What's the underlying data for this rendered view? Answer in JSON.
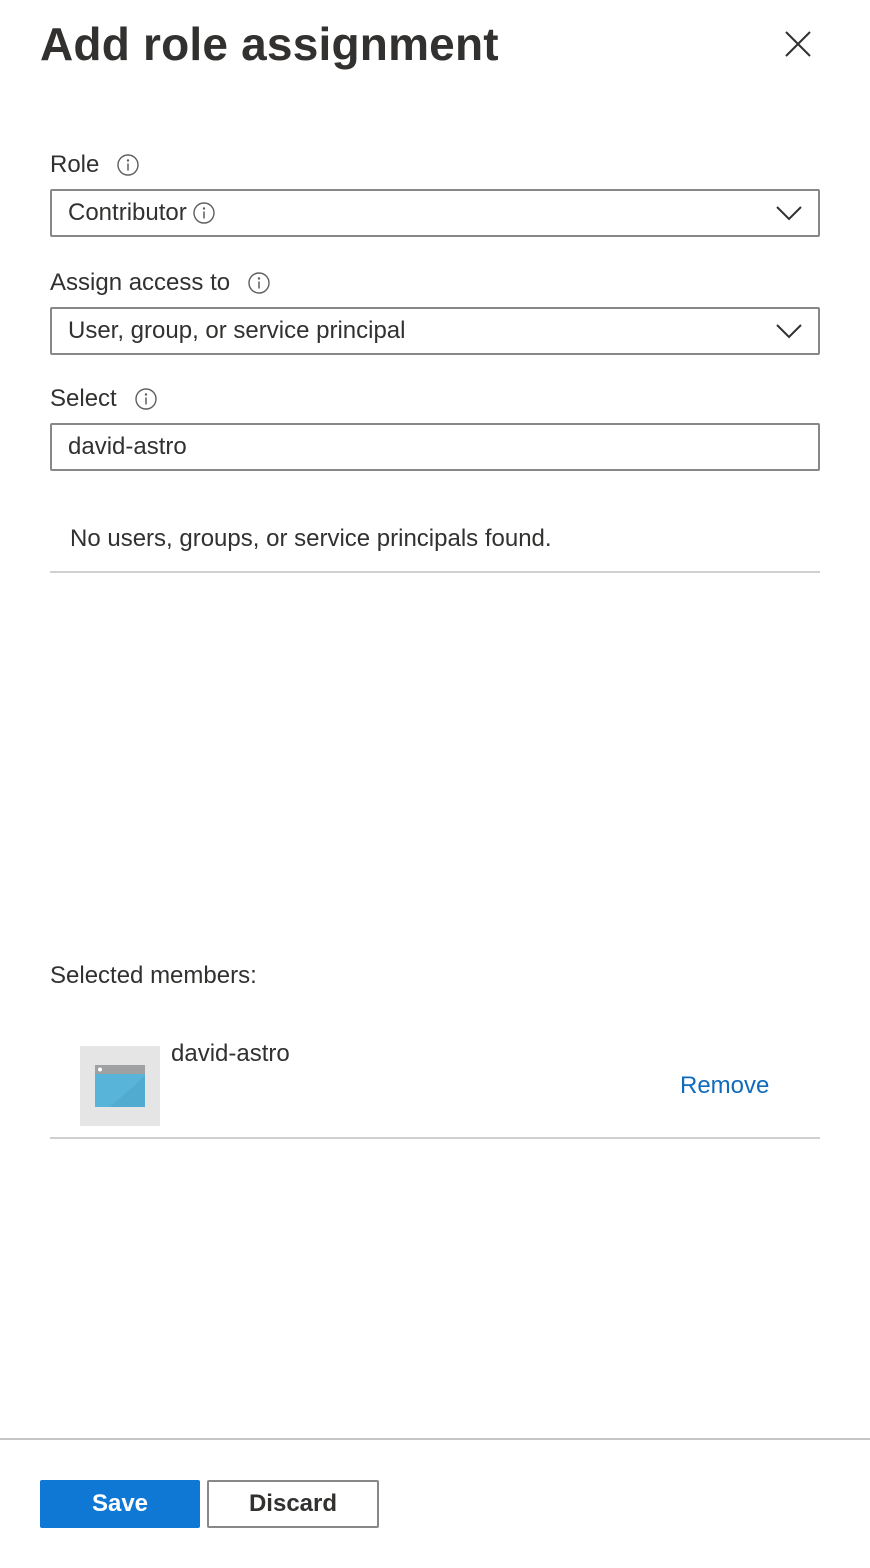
{
  "panel": {
    "title": "Add role assignment"
  },
  "role": {
    "label": "Role",
    "value": "Contributor"
  },
  "assign_access": {
    "label": "Assign access to",
    "value": "User, group, or service principal"
  },
  "select": {
    "label": "Select",
    "value": "david-astro"
  },
  "results": {
    "empty_message": "No users, groups, or service principals found."
  },
  "selected_members": {
    "label": "Selected members:",
    "items": [
      {
        "name": "david-astro",
        "remove_label": "Remove",
        "icon": "app-window-icon"
      }
    ]
  },
  "footer": {
    "save_label": "Save",
    "discard_label": "Discard"
  },
  "colors": {
    "primary": "#0f78d4",
    "link": "#0f6cbd",
    "border": "#8a8886",
    "text": "#323130"
  }
}
